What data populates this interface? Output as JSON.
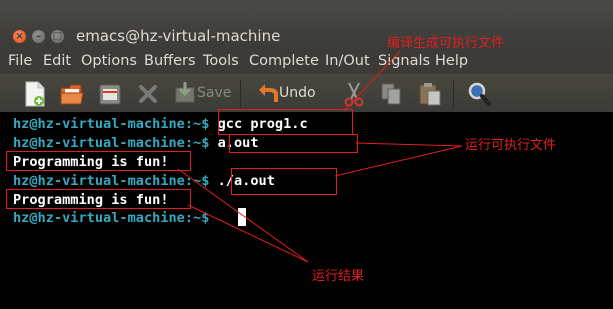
{
  "window": {
    "title": "emacs@hz-virtual-machine"
  },
  "menu": {
    "items": [
      "File",
      "Edit",
      "Options",
      "Buffers",
      "Tools",
      "Complete",
      "In/Out",
      "Signals",
      "Help"
    ]
  },
  "toolbar": {
    "new_icon": "new-file-icon",
    "open_icon": "open-folder-icon",
    "save_label": "Save",
    "undo_label": "Undo"
  },
  "terminal": {
    "prompt": "hz@hz-virtual-machine:~$",
    "lines": [
      {
        "prompt": "hz@hz-virtual-machine:~$",
        "command": " gcc prog1.c"
      },
      {
        "prompt": "hz@hz-virtual-machine:~$",
        "command": " a.out"
      },
      {
        "output": "Programming is fun!"
      },
      {
        "prompt": "hz@hz-virtual-machine:~$",
        "command": " ./a.out"
      },
      {
        "output": "Programming is fun!"
      },
      {
        "prompt": "hz@hz-virtual-machine:~$",
        "command": ""
      }
    ]
  },
  "annotations": {
    "compile": "编译生成可执行文件",
    "run": "运行可执行文件",
    "result": "运行结果"
  },
  "colors": {
    "prompt": "#35a9bf",
    "annotation": "#e02020",
    "titlebar": "#3c3b37",
    "close_button": "#df4a16"
  }
}
